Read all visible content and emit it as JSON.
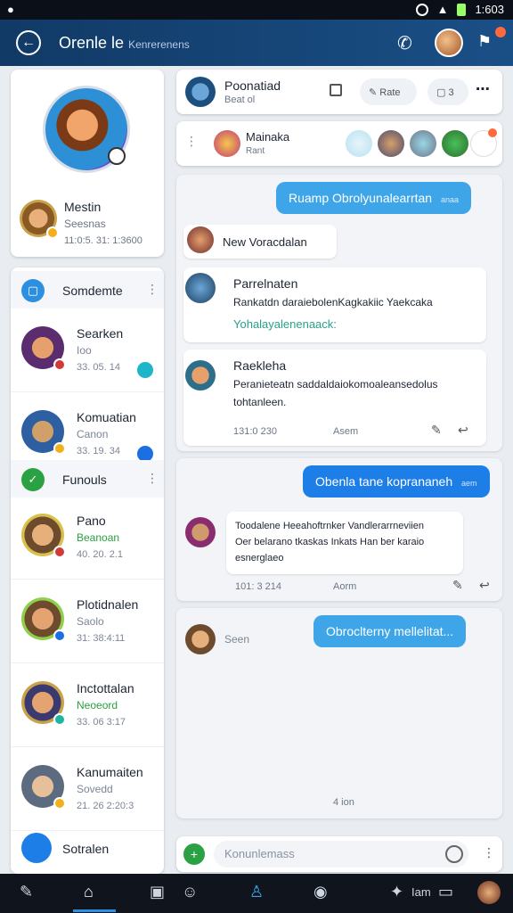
{
  "status_bar": {
    "time": "1:603"
  },
  "app_bar": {
    "title": "Orenle le",
    "subtitle": "Kenrerenens"
  },
  "profile": {
    "name": "Mestin",
    "subtitle": "Seesnas",
    "meta": "11:0:5. 31: 1:3600"
  },
  "sections": [
    {
      "label": "Somdemte"
    },
    {
      "label": "Funouls"
    }
  ],
  "contacts": [
    {
      "name": "Searken",
      "sub": "Ioo",
      "time": "33. 05. 14"
    },
    {
      "name": "Komuatian",
      "sub": "Canon",
      "time": "33. 19. 34"
    },
    {
      "name": "Pano",
      "sub": "Beanoan",
      "time": "40. 20. 2.1"
    },
    {
      "name": "Plotidnalen",
      "sub": "Saolo",
      "time": "31: 38:4:11"
    },
    {
      "name": "Inctottalan",
      "sub": "Neoeord",
      "time": "33. 06 3:17"
    },
    {
      "name": "Kanumaiten",
      "sub": "Sovedd",
      "time": "21. 26 2:20:3"
    },
    {
      "name": "Sotralen",
      "sub": "",
      "time": ""
    }
  ],
  "chat_header": {
    "name": "Poonatiad",
    "sub": "Beat ol",
    "btn1": "Rate",
    "btn2": "3"
  },
  "participants": {
    "name": "Mainaka",
    "sub": "Rant"
  },
  "messages": {
    "out1": "Ruamp Obrolyunalearrtan",
    "out1_small": "anaa",
    "in1_name": "New Voracdalan",
    "in2_name": "Parrelnaten",
    "in2_line1": "Rankatdn daraiebolenKagkakiic Yaekcaka",
    "in2_line2": "Yohalayalenenaack:",
    "in3_name": "Raekleha",
    "in3_line1": "Peranieteatn saddaldaiokomoaleansedolus",
    "in3_line2": "tohtanleen.",
    "t1_time": "131:0 230",
    "t1_mid": "Asem",
    "out2": "Obenla tane koprananeh",
    "out2_small": "aem",
    "in4_line1": "Toodalene Heeahoftrnker Vandlerarrneviien",
    "in4_line2": "Oer belarano tkaskas Inkats Han ber karaio",
    "in4_line3": "esnerglaeo",
    "t2_time": "101: 3 214",
    "t2_mid": "Aorm",
    "out3": "Obroclterny mellelitat...",
    "out3_small": "",
    "seen": "Seen",
    "t3": "4 ion"
  },
  "composer": {
    "placeholder": "Konunlemass"
  },
  "nav": {
    "label": "Iam"
  }
}
